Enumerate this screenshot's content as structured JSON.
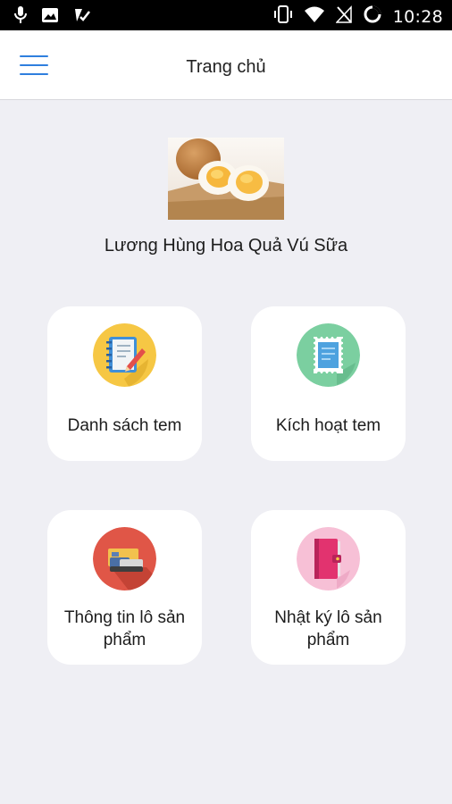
{
  "status_bar": {
    "time": "10:28",
    "icons": [
      "microphone-icon",
      "image-icon",
      "checkmark-icon",
      "vibrate-icon",
      "wifi-icon",
      "no-signal-icon",
      "battery-icon"
    ]
  },
  "header": {
    "title": "Trang chủ",
    "menu_icon": "hamburger-menu-icon",
    "accent_color": "#2f7fde"
  },
  "shop": {
    "name": "Lương Hùng Hoa Quả Vú Sữa",
    "image": "boiled-eggs-photo"
  },
  "menu": [
    {
      "label": "Danh sách tem",
      "icon": "notebook-icon",
      "color": "#f6c744"
    },
    {
      "label": "Kích hoạt tem",
      "icon": "stamp-icon",
      "color": "#7bcfa0"
    },
    {
      "label": "Thông tin lô sản phẩm",
      "icon": "wallet-card-icon",
      "color": "#e05647"
    },
    {
      "label": "Nhật ký lô sản phẩm",
      "icon": "diary-icon",
      "color": "#f7c0d6"
    }
  ]
}
